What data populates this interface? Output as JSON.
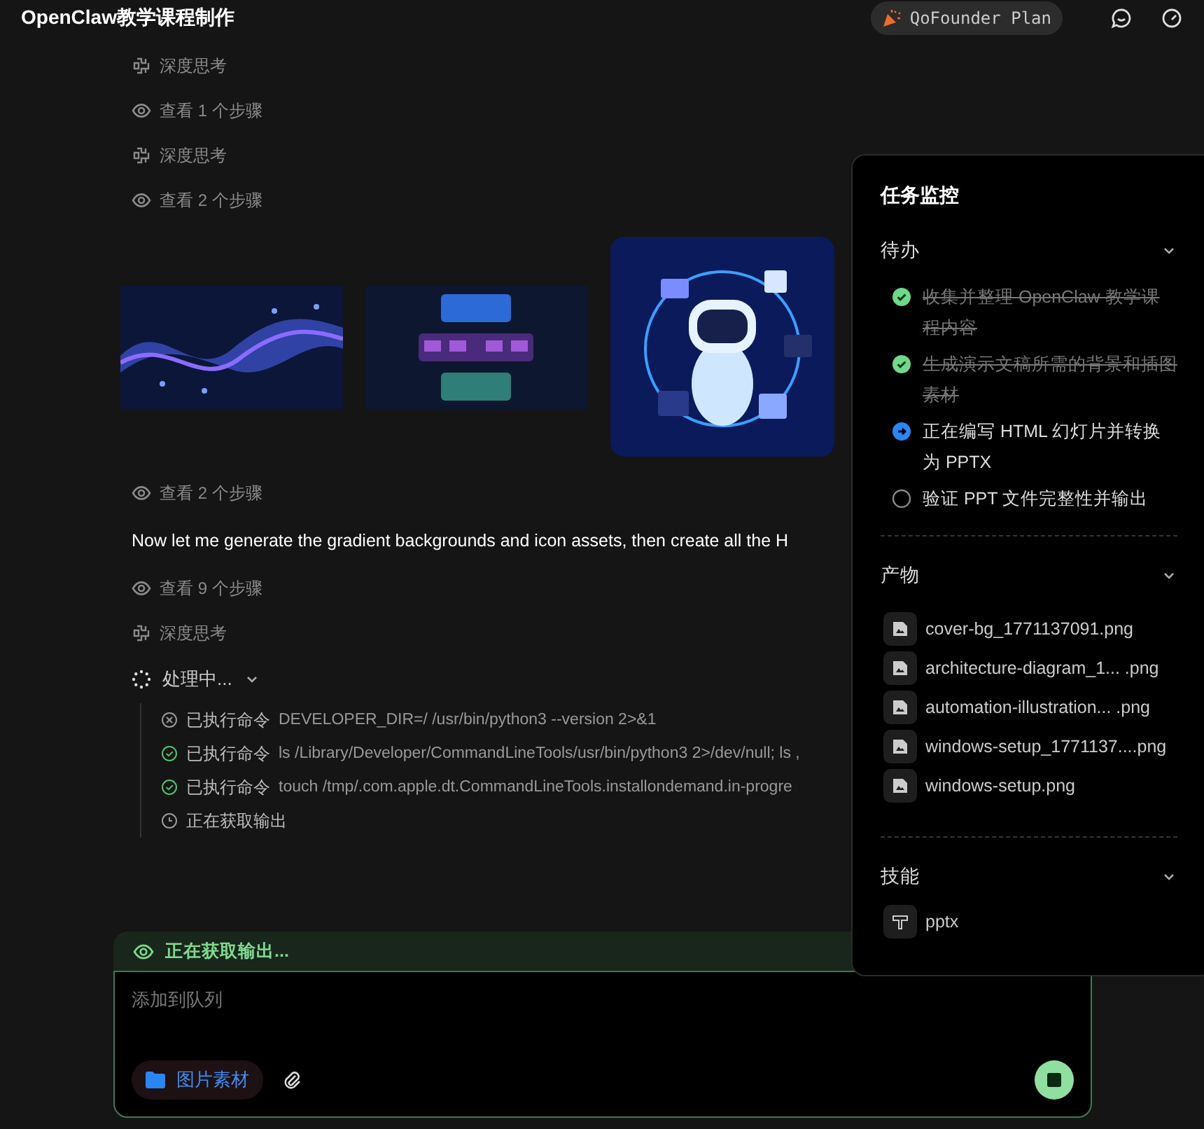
{
  "window": {
    "title": "OpenClaw教学课程制作"
  },
  "header": {
    "plan": "QoFounder Plan"
  },
  "timeline": [
    {
      "kind": "thinking",
      "label": "深度思考"
    },
    {
      "kind": "steps",
      "label": "查看 1 个步骤"
    },
    {
      "kind": "thinking",
      "label": "深度思考"
    },
    {
      "kind": "steps",
      "label": "查看 2 个步骤"
    },
    {
      "kind": "images"
    },
    {
      "kind": "steps",
      "label": "查看 2 个步骤"
    },
    {
      "kind": "message",
      "text": "Now let me generate the gradient backgrounds and icon assets, then create all the H"
    },
    {
      "kind": "steps",
      "label": "查看 9 个步骤"
    },
    {
      "kind": "thinking",
      "label": "深度思考"
    },
    {
      "kind": "processing",
      "label": "处理中...",
      "expanded": true,
      "commands": [
        {
          "kind": "failed",
          "label": "已执行命令",
          "command": "DEVELOPER_DIR=/ /usr/bin/python3 --version 2>&1"
        },
        {
          "kind": "done",
          "label": "已执行命令",
          "command": "ls /Library/Developer/CommandLineTools/usr/bin/python3 2>/dev/null; ls ,"
        },
        {
          "kind": "done",
          "label": "已执行命令",
          "command": "touch /tmp/.com.apple.dt.CommandLineTools.installondemand.in-progre"
        },
        {
          "kind": "pending",
          "label": "正在获取输出"
        }
      ]
    }
  ],
  "composer": {
    "status": "正在获取输出...",
    "placeholder": "添加到队列",
    "folder_chip": "图片素材"
  },
  "monitor": {
    "title": "任务监控",
    "todo": {
      "title": "待办",
      "expanded": true,
      "items": [
        {
          "kind": "done",
          "text": "收集并整理 OpenClaw 教学课程内容"
        },
        {
          "kind": "done",
          "text": "生成演示文稿所需的背景和插图素材"
        },
        {
          "kind": "active",
          "text": "正在编写 HTML 幻灯片并转换为 PPTX"
        },
        {
          "kind": "todo",
          "text": "验证 PPT 文件完整性并输出"
        }
      ]
    },
    "artifacts": {
      "title": "产物",
      "expanded": true,
      "files": [
        {
          "name": "cover-bg_1771137091.png"
        },
        {
          "name": "architecture-diagram_1... .png"
        },
        {
          "name": "automation-illustration... .png"
        },
        {
          "name": "windows-setup_1771137....png"
        },
        {
          "name": "windows-setup.png"
        }
      ]
    },
    "skills": {
      "title": "技能",
      "expanded": true,
      "items": [
        {
          "name": "pptx"
        }
      ]
    }
  }
}
